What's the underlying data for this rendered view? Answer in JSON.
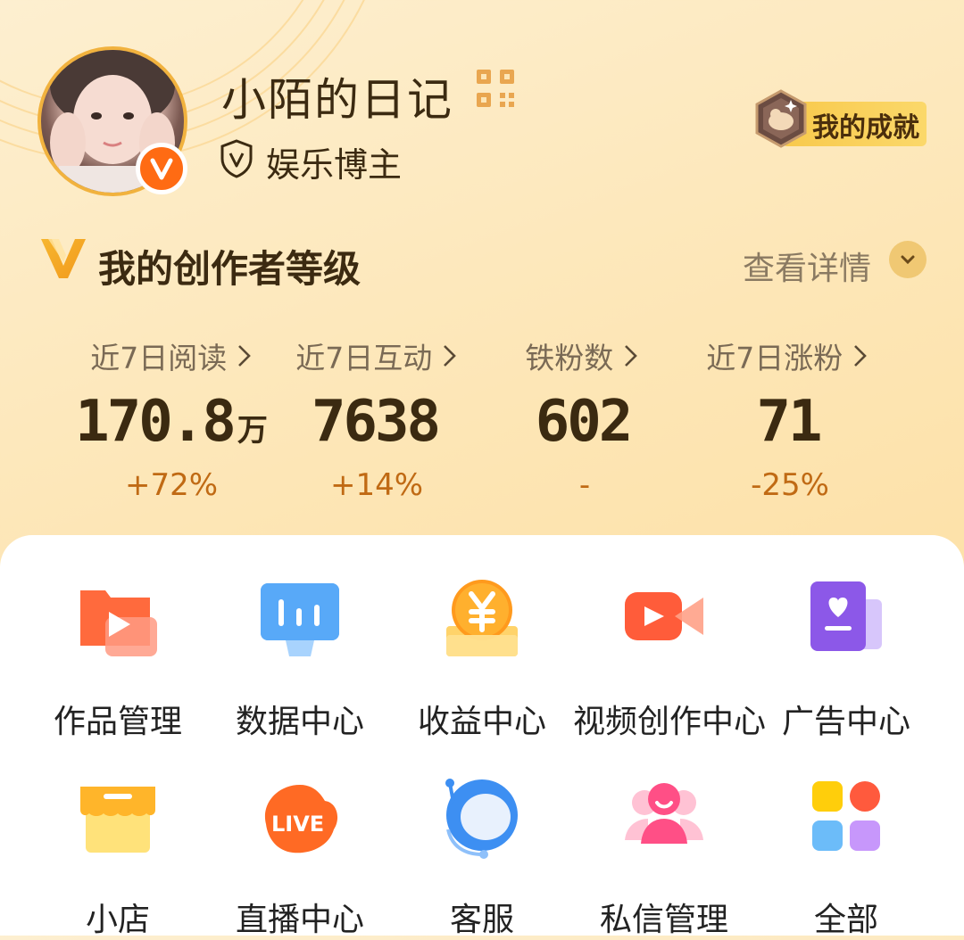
{
  "profile": {
    "name": "小陌的日记",
    "role": "娱乐博主",
    "achievement_label": "我的成就"
  },
  "icons": {
    "avatar": "avatar-photo",
    "verified": "v-verified-icon",
    "qr": "qr-code-icon",
    "role": "shield-v-icon",
    "achievement": "medal-icon",
    "level": "v-level-icon",
    "chevron": "chevron-right-icon",
    "detail": "chevron-down-icon"
  },
  "level": {
    "title": "我的创作者等级",
    "detail_label": "查看详情"
  },
  "stats": [
    {
      "label": "近7日阅读",
      "value": "170.8",
      "unit": "万",
      "change": "+72%"
    },
    {
      "label": "近7日互动",
      "value": "7638",
      "unit": "",
      "change": "+14%"
    },
    {
      "label": "铁粉数",
      "value": "602",
      "unit": "",
      "change": "-"
    },
    {
      "label": "近7日涨粉",
      "value": "71",
      "unit": "",
      "change": "-25%"
    }
  ],
  "menu": [
    {
      "label": "作品管理",
      "icon": "works-folder-icon"
    },
    {
      "label": "数据中心",
      "icon": "data-chart-icon"
    },
    {
      "label": "收益中心",
      "icon": "yen-coin-icon"
    },
    {
      "label": "视频创作中心",
      "icon": "video-camera-icon"
    },
    {
      "label": "广告中心",
      "icon": "ad-book-heart-icon"
    },
    {
      "label": "小店",
      "icon": "shop-icon"
    },
    {
      "label": "直播中心",
      "icon": "live-icon"
    },
    {
      "label": "客服",
      "icon": "customer-service-icon"
    },
    {
      "label": "私信管理",
      "icon": "private-message-icon"
    },
    {
      "label": "全部",
      "icon": "all-apps-icon"
    }
  ],
  "colors": {
    "accent": "#ff6b13",
    "change_text": "#c06a14",
    "badge_gold": "#f8c94c"
  }
}
